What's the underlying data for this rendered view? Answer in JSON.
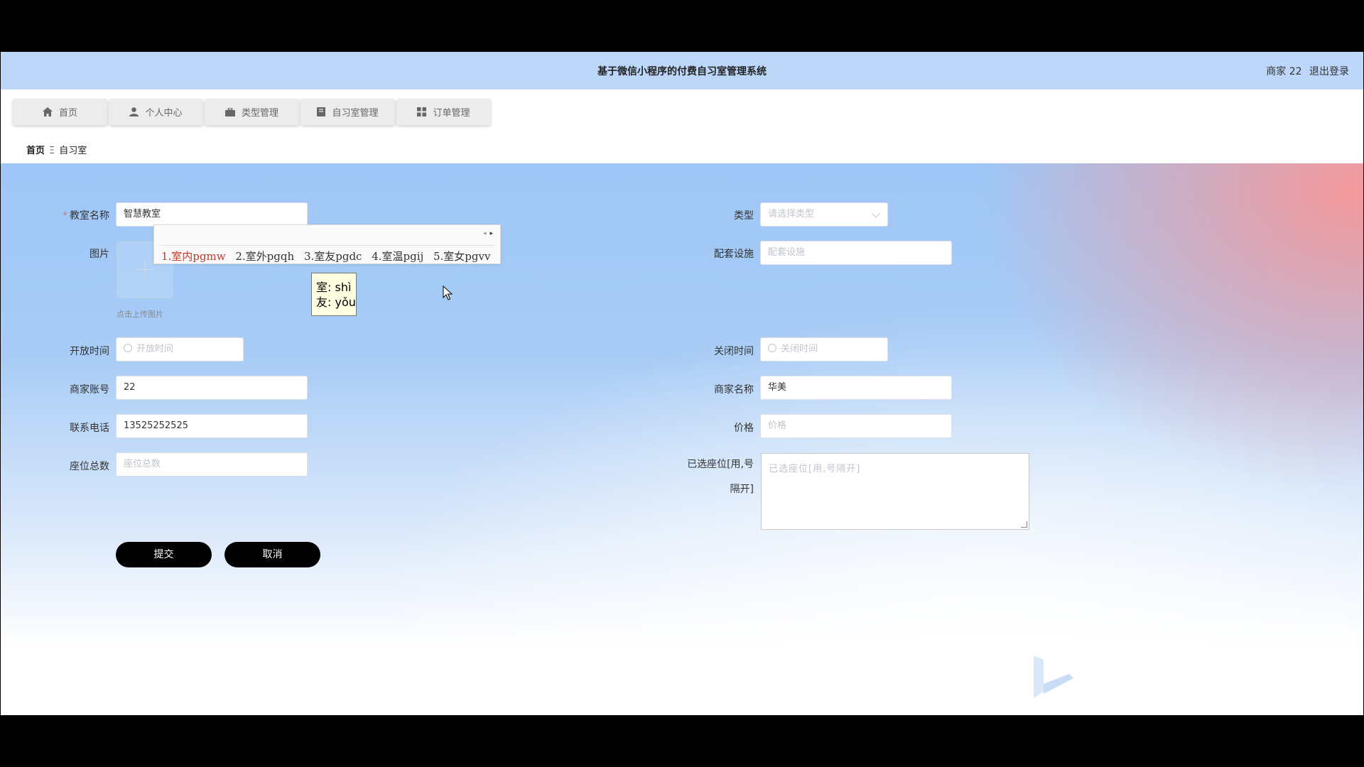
{
  "header": {
    "title": "基于微信小程序的付费自习室管理系统",
    "user_label": "商家 22",
    "logout_label": "退出登录"
  },
  "nav": {
    "tabs": [
      {
        "label": "首页",
        "icon": "home-icon"
      },
      {
        "label": "个人中心",
        "icon": "user-icon"
      },
      {
        "label": "类型管理",
        "icon": "briefcase-icon"
      },
      {
        "label": "自习室管理",
        "icon": "book-icon"
      },
      {
        "label": "订单管理",
        "icon": "grid-icon"
      }
    ]
  },
  "breadcrumb": {
    "home": "首页",
    "separator": "Ξ",
    "current": "自习室"
  },
  "form": {
    "classroom_name": {
      "label": "教室名称",
      "value": "智慧教室"
    },
    "type": {
      "label": "类型",
      "placeholder": "请选择类型"
    },
    "image": {
      "label": "图片",
      "upload_tip": "点击上传图片"
    },
    "facilities": {
      "label": "配套设施",
      "placeholder": "配套设施"
    },
    "open_time": {
      "label": "开放时间",
      "placeholder": "开放时间"
    },
    "close_time": {
      "label": "关闭时间",
      "placeholder": "关闭时间"
    },
    "merchant_account": {
      "label": "商家账号",
      "value": "22"
    },
    "merchant_name": {
      "label": "商家名称",
      "value": "华美"
    },
    "phone": {
      "label": "联系电话",
      "value": "13525252525"
    },
    "price": {
      "label": "价格",
      "placeholder": "价格"
    },
    "seat_total": {
      "label": "座位总数",
      "placeholder": "座位总数"
    },
    "selected_seats": {
      "label_line1": "已选座位[用,号",
      "label_line2": "隔开]",
      "placeholder": "已选座位[用,号隔开]"
    },
    "submit_label": "提交",
    "cancel_label": "取消"
  },
  "ime": {
    "candidates": [
      "1.室内pgmw",
      "2.室外pgqh",
      "3.室友pgdc",
      "4.室温pgij",
      "5.室女pgvv"
    ],
    "tooltip_line1": "室: shì",
    "tooltip_line2": "友: yǒu"
  },
  "colors": {
    "header_bg": "#bcd7fa",
    "button_bg": "#000000",
    "required": "#f56c6c",
    "ime_selected": "#c0392b"
  }
}
